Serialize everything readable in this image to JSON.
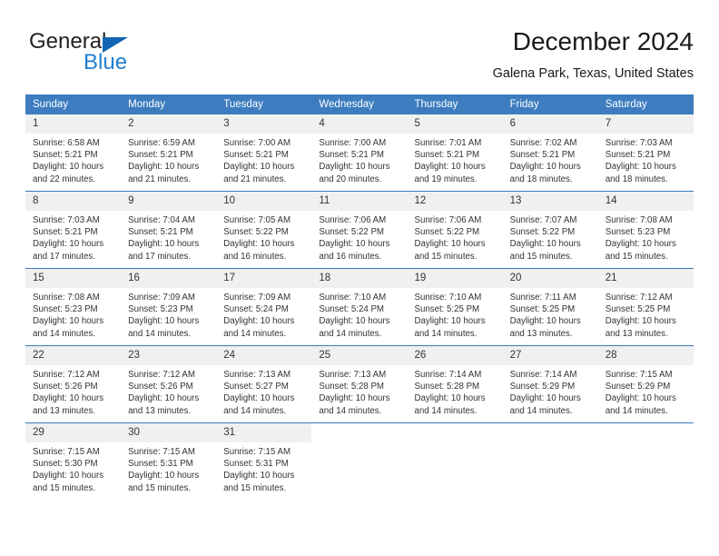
{
  "brand": {
    "primary_text": "General",
    "secondary_text": "Blue",
    "primary_color": "#231f20",
    "secondary_color": "#1f7fd0",
    "triangle_color": "#1266b4"
  },
  "header": {
    "title": "December 2024",
    "subtitle": "Galena Park, Texas, United States"
  },
  "theme": {
    "header_bg": "#3c7cbf",
    "header_text": "#ffffff",
    "daynum_bg": "#f0f0f0",
    "body_text": "#333333"
  },
  "weekdays": [
    "Sunday",
    "Monday",
    "Tuesday",
    "Wednesday",
    "Thursday",
    "Friday",
    "Saturday"
  ],
  "weeks": [
    [
      {
        "day": "1",
        "sunrise": "Sunrise: 6:58 AM",
        "sunset": "Sunset: 5:21 PM",
        "daylight1": "Daylight: 10 hours",
        "daylight2": "and 22 minutes."
      },
      {
        "day": "2",
        "sunrise": "Sunrise: 6:59 AM",
        "sunset": "Sunset: 5:21 PM",
        "daylight1": "Daylight: 10 hours",
        "daylight2": "and 21 minutes."
      },
      {
        "day": "3",
        "sunrise": "Sunrise: 7:00 AM",
        "sunset": "Sunset: 5:21 PM",
        "daylight1": "Daylight: 10 hours",
        "daylight2": "and 21 minutes."
      },
      {
        "day": "4",
        "sunrise": "Sunrise: 7:00 AM",
        "sunset": "Sunset: 5:21 PM",
        "daylight1": "Daylight: 10 hours",
        "daylight2": "and 20 minutes."
      },
      {
        "day": "5",
        "sunrise": "Sunrise: 7:01 AM",
        "sunset": "Sunset: 5:21 PM",
        "daylight1": "Daylight: 10 hours",
        "daylight2": "and 19 minutes."
      },
      {
        "day": "6",
        "sunrise": "Sunrise: 7:02 AM",
        "sunset": "Sunset: 5:21 PM",
        "daylight1": "Daylight: 10 hours",
        "daylight2": "and 18 minutes."
      },
      {
        "day": "7",
        "sunrise": "Sunrise: 7:03 AM",
        "sunset": "Sunset: 5:21 PM",
        "daylight1": "Daylight: 10 hours",
        "daylight2": "and 18 minutes."
      }
    ],
    [
      {
        "day": "8",
        "sunrise": "Sunrise: 7:03 AM",
        "sunset": "Sunset: 5:21 PM",
        "daylight1": "Daylight: 10 hours",
        "daylight2": "and 17 minutes."
      },
      {
        "day": "9",
        "sunrise": "Sunrise: 7:04 AM",
        "sunset": "Sunset: 5:21 PM",
        "daylight1": "Daylight: 10 hours",
        "daylight2": "and 17 minutes."
      },
      {
        "day": "10",
        "sunrise": "Sunrise: 7:05 AM",
        "sunset": "Sunset: 5:22 PM",
        "daylight1": "Daylight: 10 hours",
        "daylight2": "and 16 minutes."
      },
      {
        "day": "11",
        "sunrise": "Sunrise: 7:06 AM",
        "sunset": "Sunset: 5:22 PM",
        "daylight1": "Daylight: 10 hours",
        "daylight2": "and 16 minutes."
      },
      {
        "day": "12",
        "sunrise": "Sunrise: 7:06 AM",
        "sunset": "Sunset: 5:22 PM",
        "daylight1": "Daylight: 10 hours",
        "daylight2": "and 15 minutes."
      },
      {
        "day": "13",
        "sunrise": "Sunrise: 7:07 AM",
        "sunset": "Sunset: 5:22 PM",
        "daylight1": "Daylight: 10 hours",
        "daylight2": "and 15 minutes."
      },
      {
        "day": "14",
        "sunrise": "Sunrise: 7:08 AM",
        "sunset": "Sunset: 5:23 PM",
        "daylight1": "Daylight: 10 hours",
        "daylight2": "and 15 minutes."
      }
    ],
    [
      {
        "day": "15",
        "sunrise": "Sunrise: 7:08 AM",
        "sunset": "Sunset: 5:23 PM",
        "daylight1": "Daylight: 10 hours",
        "daylight2": "and 14 minutes."
      },
      {
        "day": "16",
        "sunrise": "Sunrise: 7:09 AM",
        "sunset": "Sunset: 5:23 PM",
        "daylight1": "Daylight: 10 hours",
        "daylight2": "and 14 minutes."
      },
      {
        "day": "17",
        "sunrise": "Sunrise: 7:09 AM",
        "sunset": "Sunset: 5:24 PM",
        "daylight1": "Daylight: 10 hours",
        "daylight2": "and 14 minutes."
      },
      {
        "day": "18",
        "sunrise": "Sunrise: 7:10 AM",
        "sunset": "Sunset: 5:24 PM",
        "daylight1": "Daylight: 10 hours",
        "daylight2": "and 14 minutes."
      },
      {
        "day": "19",
        "sunrise": "Sunrise: 7:10 AM",
        "sunset": "Sunset: 5:25 PM",
        "daylight1": "Daylight: 10 hours",
        "daylight2": "and 14 minutes."
      },
      {
        "day": "20",
        "sunrise": "Sunrise: 7:11 AM",
        "sunset": "Sunset: 5:25 PM",
        "daylight1": "Daylight: 10 hours",
        "daylight2": "and 13 minutes."
      },
      {
        "day": "21",
        "sunrise": "Sunrise: 7:12 AM",
        "sunset": "Sunset: 5:25 PM",
        "daylight1": "Daylight: 10 hours",
        "daylight2": "and 13 minutes."
      }
    ],
    [
      {
        "day": "22",
        "sunrise": "Sunrise: 7:12 AM",
        "sunset": "Sunset: 5:26 PM",
        "daylight1": "Daylight: 10 hours",
        "daylight2": "and 13 minutes."
      },
      {
        "day": "23",
        "sunrise": "Sunrise: 7:12 AM",
        "sunset": "Sunset: 5:26 PM",
        "daylight1": "Daylight: 10 hours",
        "daylight2": "and 13 minutes."
      },
      {
        "day": "24",
        "sunrise": "Sunrise: 7:13 AM",
        "sunset": "Sunset: 5:27 PM",
        "daylight1": "Daylight: 10 hours",
        "daylight2": "and 14 minutes."
      },
      {
        "day": "25",
        "sunrise": "Sunrise: 7:13 AM",
        "sunset": "Sunset: 5:28 PM",
        "daylight1": "Daylight: 10 hours",
        "daylight2": "and 14 minutes."
      },
      {
        "day": "26",
        "sunrise": "Sunrise: 7:14 AM",
        "sunset": "Sunset: 5:28 PM",
        "daylight1": "Daylight: 10 hours",
        "daylight2": "and 14 minutes."
      },
      {
        "day": "27",
        "sunrise": "Sunrise: 7:14 AM",
        "sunset": "Sunset: 5:29 PM",
        "daylight1": "Daylight: 10 hours",
        "daylight2": "and 14 minutes."
      },
      {
        "day": "28",
        "sunrise": "Sunrise: 7:15 AM",
        "sunset": "Sunset: 5:29 PM",
        "daylight1": "Daylight: 10 hours",
        "daylight2": "and 14 minutes."
      }
    ],
    [
      {
        "day": "29",
        "sunrise": "Sunrise: 7:15 AM",
        "sunset": "Sunset: 5:30 PM",
        "daylight1": "Daylight: 10 hours",
        "daylight2": "and 15 minutes."
      },
      {
        "day": "30",
        "sunrise": "Sunrise: 7:15 AM",
        "sunset": "Sunset: 5:31 PM",
        "daylight1": "Daylight: 10 hours",
        "daylight2": "and 15 minutes."
      },
      {
        "day": "31",
        "sunrise": "Sunrise: 7:15 AM",
        "sunset": "Sunset: 5:31 PM",
        "daylight1": "Daylight: 10 hours",
        "daylight2": "and 15 minutes."
      },
      {
        "day": "",
        "sunrise": "",
        "sunset": "",
        "daylight1": "",
        "daylight2": ""
      },
      {
        "day": "",
        "sunrise": "",
        "sunset": "",
        "daylight1": "",
        "daylight2": ""
      },
      {
        "day": "",
        "sunrise": "",
        "sunset": "",
        "daylight1": "",
        "daylight2": ""
      },
      {
        "day": "",
        "sunrise": "",
        "sunset": "",
        "daylight1": "",
        "daylight2": ""
      }
    ]
  ]
}
